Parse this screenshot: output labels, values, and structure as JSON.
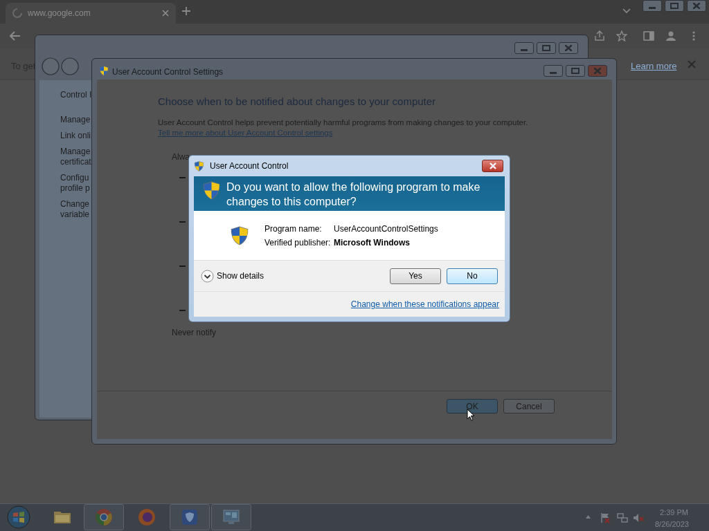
{
  "browser": {
    "tab_title": "www.google.com",
    "infobar_text": "To get",
    "infobar_link": "Learn more"
  },
  "control_panel": {
    "header": "Control I",
    "items": [
      {
        "lines": [
          "Manage"
        ]
      },
      {
        "lines": [
          "Link onli"
        ]
      },
      {
        "lines": [
          "Manage",
          "certificat"
        ]
      },
      {
        "lines": [
          "Configu",
          "profile p"
        ]
      },
      {
        "lines": [
          "Change",
          "variable"
        ]
      }
    ]
  },
  "settings_window": {
    "title": "User Account Control Settings",
    "heading": "Choose when to be notified about changes to your computer",
    "description": "User Account Control helps prevent potentially harmful programs from making changes to your computer.",
    "link": "Tell me more about User Account Control settings",
    "top_label": "Alwa",
    "bottom_label": "Never notify",
    "buttons": [
      {
        "label": "OK",
        "default": true
      },
      {
        "label": "Cancel",
        "default": false
      }
    ]
  },
  "uac_dialog": {
    "title": "User Account Control",
    "question": "Do you want to allow the following program to make changes to this computer?",
    "fields": [
      {
        "label": "Program name:",
        "value": "UserAccountControlSettings",
        "bold": false
      },
      {
        "label": "Verified publisher:",
        "value": "Microsoft Windows",
        "bold": true
      }
    ],
    "details": "Show details",
    "buttons": [
      {
        "label": "Yes",
        "focused": false
      },
      {
        "label": "No",
        "focused": true
      }
    ],
    "link": "Change when these notifications appear"
  },
  "taskbar": {
    "apps": [
      {
        "kind": "folder",
        "running": false
      },
      {
        "kind": "chrome",
        "running": true
      },
      {
        "kind": "firefox",
        "running": false
      },
      {
        "kind": "shield",
        "running": true
      },
      {
        "kind": "panel",
        "running": true
      }
    ],
    "time": "2:39 PM",
    "date": "8/26/2023"
  }
}
